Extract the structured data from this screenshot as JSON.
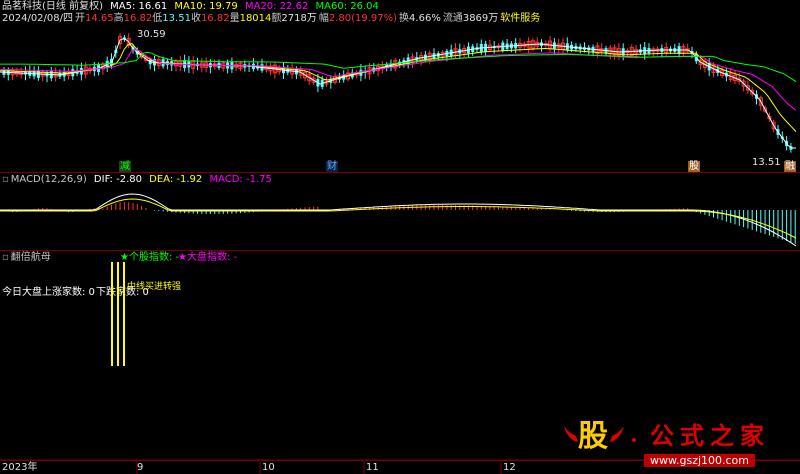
{
  "stock": {
    "name": "品茗科技(日线 前复权)",
    "ma5_label": "MA5: 16.61",
    "ma10_label": "MA10: 19.79",
    "ma20_label": "MA20: 22.62",
    "ma60_label": "MA60: 26.04",
    "date": "2024/02/08/四",
    "open_label": "开",
    "open": "14.65",
    "high_label": "高",
    "high": "16.82",
    "low_label": "低",
    "low": "13.51",
    "close_label": "收",
    "close": "16.82",
    "volume_label": "量",
    "volume": "18014",
    "amount_label": "额",
    "amount": "2718万",
    "change_label": "幅",
    "change": "2.80(19.97%)",
    "turnover_label": "换",
    "turnover": "4.66%",
    "float_label": "流通",
    "float": "3869万",
    "service": "软件服务",
    "price_high_marker": "30.59",
    "price_low_marker": "13.51",
    "event_marks": [
      "减",
      "财",
      "股",
      "融"
    ]
  },
  "macd": {
    "title": "MACD(12,26,9)",
    "dif": "DIF: -2.80",
    "dea": "DEA: -1.92",
    "macd": "MACD: -1.75"
  },
  "indicator": {
    "title": "翻倍航母",
    "stock_index": "★个股指数: -",
    "market_index": "★大盘指数: -",
    "advancers": "今日大盘上涨家数: 0",
    "decliners": "下跌家数: 0",
    "overlap_text": "中线买进转强"
  },
  "axis": {
    "year": "2023年",
    "months": [
      "9",
      "10",
      "11",
      "12"
    ]
  },
  "logo": {
    "symbol": "股",
    "name": "公式之家",
    "url": "www.gszj100.com"
  },
  "colors": {
    "up": "#ff3232",
    "down": "#54ffff",
    "ma5": "#ffffff",
    "ma10": "#ffff00",
    "ma20": "#ff00ff",
    "ma60": "#00ff00",
    "indicator_bar": "#ffff00"
  }
}
